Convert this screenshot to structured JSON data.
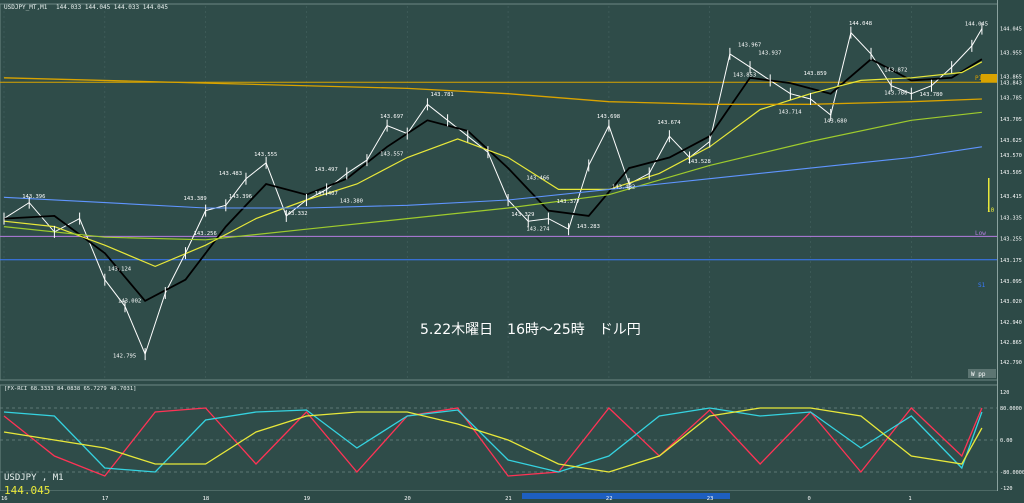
{
  "header": {
    "title": "USDJPY_MT,M1",
    "ohlc": "144.033 144.045 144.033 144.045"
  },
  "annotation": {
    "text": "5.22木曜日　16時～25時　ドル円"
  },
  "corner_label": "W pp",
  "footer": {
    "symbol": "USDJPY , M1",
    "last_price": "144.045"
  },
  "colors": {
    "background": "#2d4a47",
    "candle": "#ffffff",
    "sma_black": "#000000",
    "ma_yellow": "#e8e83a",
    "ma_green": "#9ecb2d",
    "ma_blue": "#5f95ff",
    "pivot": "#d9a300",
    "lower_band": "#b57de0",
    "s_line": "#3a7bff"
  },
  "chart_data": [
    {
      "type": "line",
      "title": "USDJPY_MT,M1",
      "x_tick_labels": [
        "16",
        "17",
        "18",
        "19",
        "20",
        "21",
        "22",
        "23",
        "0",
        "1"
      ],
      "y_tick_labels": [
        "144.045",
        "143.955",
        "143.865",
        "143.843",
        "143.785",
        "143.705",
        "143.625",
        "143.570",
        "143.505",
        "143.415",
        "143.335",
        "143.255",
        "143.175",
        "143.095",
        "143.020",
        "142.940",
        "142.865",
        "142.790"
      ],
      "ylim": [
        142.73,
        144.1
      ],
      "price_labels": [
        {
          "x": 0.3,
          "value": 143.396,
          "text": "143.396"
        },
        {
          "x": 1.25,
          "value": 143.002,
          "text": "143.002"
        },
        {
          "x": 1.15,
          "value": 143.124,
          "text": "143.124"
        },
        {
          "x": 1.2,
          "value": 142.795,
          "text": "142.795"
        },
        {
          "x": 1.9,
          "value": 143.389,
          "text": "143.389"
        },
        {
          "x": 2.25,
          "value": 143.483,
          "text": "143.483"
        },
        {
          "x": 2.6,
          "value": 143.555,
          "text": "143.555"
        },
        {
          "x": 2.35,
          "value": 143.396,
          "text": "143.396"
        },
        {
          "x": 2.0,
          "value": 143.256,
          "text": "143.256"
        },
        {
          "x": 2.9,
          "value": 143.332,
          "text": "143.332"
        },
        {
          "x": 3.2,
          "value": 143.497,
          "text": "143.497"
        },
        {
          "x": 3.45,
          "value": 143.38,
          "text": "143.380"
        },
        {
          "x": 3.2,
          "value": 143.407,
          "text": "143.407"
        },
        {
          "x": 3.85,
          "value": 143.697,
          "text": "143.697"
        },
        {
          "x": 3.85,
          "value": 143.557,
          "text": "143.557"
        },
        {
          "x": 4.35,
          "value": 143.781,
          "text": "143.781"
        },
        {
          "x": 5.3,
          "value": 143.466,
          "text": "143.466"
        },
        {
          "x": 5.15,
          "value": 143.329,
          "text": "143.329"
        },
        {
          "x": 5.6,
          "value": 143.377,
          "text": "143.377"
        },
        {
          "x": 5.3,
          "value": 143.274,
          "text": "143.274"
        },
        {
          "x": 5.8,
          "value": 143.283,
          "text": "143.283"
        },
        {
          "x": 6.0,
          "value": 143.698,
          "text": "143.698"
        },
        {
          "x": 6.15,
          "value": 143.432,
          "text": "143.432"
        },
        {
          "x": 6.6,
          "value": 143.674,
          "text": "143.674"
        },
        {
          "x": 6.9,
          "value": 143.528,
          "text": "143.528"
        },
        {
          "x": 7.4,
          "value": 143.967,
          "text": "143.967"
        },
        {
          "x": 7.6,
          "value": 143.937,
          "text": "143.937"
        },
        {
          "x": 7.35,
          "value": 143.853,
          "text": "143.853"
        },
        {
          "x": 8.05,
          "value": 143.859,
          "text": "143.859"
        },
        {
          "x": 7.8,
          "value": 143.714,
          "text": "143.714"
        },
        {
          "x": 8.25,
          "value": 143.68,
          "text": "143.680"
        },
        {
          "x": 8.5,
          "value": 144.048,
          "text": "144.048"
        },
        {
          "x": 8.85,
          "value": 143.872,
          "text": "143.872"
        },
        {
          "x": 8.85,
          "value": 143.786,
          "text": "143.786"
        },
        {
          "x": 9.2,
          "value": 143.78,
          "text": "143.780"
        },
        {
          "x": 9.65,
          "value": 144.045,
          "text": "144.045"
        }
      ],
      "horizontal_lines": [
        {
          "name": "PIVOT",
          "value": 143.843,
          "color": "#d9a300"
        },
        {
          "name": "Low",
          "value": 143.263,
          "color": "#b57de0"
        },
        {
          "name": "S1",
          "value": 143.175,
          "color": "#3a7bff"
        }
      ],
      "right_annotation": "10",
      "series": [
        {
          "color": "#ffffff",
          "x": [
            0,
            0.25,
            0.5,
            0.75,
            1.0,
            1.2,
            1.4,
            1.6,
            1.8,
            2.0,
            2.2,
            2.4,
            2.6,
            2.8,
            3.0,
            3.2,
            3.4,
            3.6,
            3.8,
            4.0,
            4.2,
            4.4,
            4.6,
            4.8,
            5.0,
            5.2,
            5.4,
            5.6,
            5.8,
            6.0,
            6.2,
            6.4,
            6.6,
            6.8,
            7.0,
            7.2,
            7.4,
            7.6,
            7.8,
            8.0,
            8.2,
            8.4,
            8.6,
            8.8,
            9.0,
            9.2,
            9.4,
            9.6,
            9.7
          ],
          "values": [
            143.33,
            143.39,
            143.28,
            143.33,
            143.1,
            143.0,
            142.82,
            143.05,
            143.2,
            143.36,
            143.38,
            143.48,
            143.54,
            143.34,
            143.4,
            143.44,
            143.5,
            143.55,
            143.68,
            143.65,
            143.76,
            143.7,
            143.64,
            143.58,
            143.4,
            143.32,
            143.33,
            143.29,
            143.53,
            143.68,
            143.46,
            143.5,
            143.64,
            143.56,
            143.62,
            143.95,
            143.9,
            143.85,
            143.8,
            143.78,
            143.72,
            144.03,
            143.95,
            143.83,
            143.8,
            143.83,
            143.9,
            143.98,
            144.045
          ]
        },
        {
          "color": "#000000",
          "x": [
            0,
            0.5,
            1.0,
            1.4,
            1.8,
            2.2,
            2.6,
            3.0,
            3.4,
            3.8,
            4.2,
            4.6,
            5.0,
            5.4,
            5.8,
            6.2,
            6.6,
            7.0,
            7.4,
            7.8,
            8.2,
            8.6,
            9.0,
            9.4,
            9.7
          ],
          "values": [
            143.33,
            143.34,
            143.2,
            143.02,
            143.1,
            143.3,
            143.46,
            143.42,
            143.48,
            143.6,
            143.7,
            143.66,
            143.52,
            143.36,
            143.34,
            143.52,
            143.56,
            143.64,
            143.86,
            143.84,
            143.8,
            143.93,
            143.85,
            143.86,
            143.93
          ]
        },
        {
          "color": "#e8e83a",
          "x": [
            0,
            0.5,
            1.0,
            1.5,
            2.0,
            2.5,
            3.0,
            3.5,
            4.0,
            4.5,
            5.0,
            5.5,
            6.0,
            6.5,
            7.0,
            7.5,
            8.0,
            8.5,
            9.0,
            9.5,
            9.7
          ],
          "values": [
            143.32,
            143.3,
            143.23,
            143.15,
            143.23,
            143.33,
            143.4,
            143.46,
            143.56,
            143.63,
            143.56,
            143.44,
            143.44,
            143.5,
            143.6,
            143.74,
            143.8,
            143.85,
            143.86,
            143.88,
            143.92
          ]
        },
        {
          "color": "#9ecb2d",
          "x": [
            0,
            1.0,
            2.0,
            3.0,
            4.0,
            5.0,
            6.0,
            7.0,
            8.0,
            9.0,
            9.7
          ],
          "values": [
            143.3,
            143.26,
            143.25,
            143.29,
            143.33,
            143.37,
            143.42,
            143.53,
            143.62,
            143.7,
            143.73
          ]
        },
        {
          "color": "#5f95ff",
          "x": [
            0,
            1.0,
            2.0,
            3.0,
            4.0,
            5.0,
            6.0,
            7.0,
            8.0,
            9.0,
            9.7
          ],
          "values": [
            143.41,
            143.39,
            143.37,
            143.37,
            143.38,
            143.4,
            143.44,
            143.48,
            143.52,
            143.56,
            143.6
          ]
        },
        {
          "color": "#d9a300",
          "x": [
            0,
            2.0,
            4.0,
            5.0,
            6.0,
            7.0,
            8.0,
            9.0,
            9.7
          ],
          "values": [
            143.86,
            143.84,
            143.82,
            143.8,
            143.77,
            143.76,
            143.76,
            143.77,
            143.78
          ]
        }
      ]
    },
    {
      "type": "line",
      "title": "[FX-RCI 68.3333 84.0838 65.7279 49.7031]",
      "y_tick_labels": [
        "120",
        "80.0000",
        "0.00",
        "-80.0000",
        "-120"
      ],
      "ylim": [
        -120,
        120
      ],
      "series": [
        {
          "color": "#ff3355",
          "x": [
            0,
            0.5,
            1.0,
            1.5,
            2.0,
            2.5,
            3.0,
            3.5,
            4.0,
            4.5,
            5.0,
            5.5,
            6.0,
            6.5,
            7.0,
            7.5,
            8.0,
            8.5,
            9.0,
            9.5,
            9.7
          ],
          "values": [
            60,
            -40,
            -90,
            70,
            80,
            -60,
            70,
            -80,
            60,
            80,
            -90,
            -80,
            80,
            -40,
            75,
            -60,
            70,
            -80,
            80,
            -40,
            80
          ]
        },
        {
          "color": "#35d3e0",
          "x": [
            0,
            0.5,
            1.0,
            1.5,
            2.0,
            2.5,
            3.0,
            3.5,
            4.0,
            4.5,
            5.0,
            5.5,
            6.0,
            6.5,
            7.0,
            7.5,
            8.0,
            8.5,
            9.0,
            9.5,
            9.7
          ],
          "values": [
            70,
            60,
            -70,
            -80,
            50,
            70,
            75,
            -20,
            60,
            75,
            -50,
            -80,
            -40,
            60,
            80,
            60,
            70,
            -20,
            60,
            -70,
            70
          ]
        },
        {
          "color": "#e8e83a",
          "x": [
            0,
            0.5,
            1.0,
            1.5,
            2.0,
            2.5,
            3.0,
            3.5,
            4.0,
            4.5,
            5.0,
            5.5,
            6.0,
            6.5,
            7.0,
            7.5,
            8.0,
            8.5,
            9.0,
            9.5,
            9.7
          ],
          "values": [
            20,
            0,
            -20,
            -60,
            -60,
            20,
            60,
            70,
            70,
            40,
            0,
            -60,
            -80,
            -40,
            60,
            80,
            80,
            60,
            -40,
            -60,
            30
          ]
        }
      ]
    }
  ]
}
